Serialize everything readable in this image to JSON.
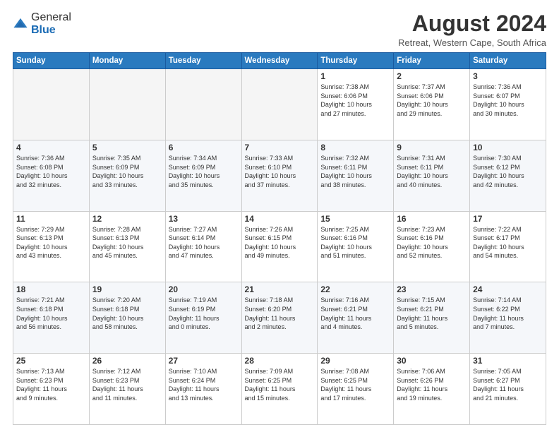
{
  "logo": {
    "general": "General",
    "blue": "Blue"
  },
  "title": "August 2024",
  "location": "Retreat, Western Cape, South Africa",
  "days_of_week": [
    "Sunday",
    "Monday",
    "Tuesday",
    "Wednesday",
    "Thursday",
    "Friday",
    "Saturday"
  ],
  "weeks": [
    [
      {
        "day": "",
        "info": "",
        "empty": true
      },
      {
        "day": "",
        "info": "",
        "empty": true
      },
      {
        "day": "",
        "info": "",
        "empty": true
      },
      {
        "day": "",
        "info": "",
        "empty": true
      },
      {
        "day": "1",
        "info": "Sunrise: 7:38 AM\nSunset: 6:06 PM\nDaylight: 10 hours\nand 27 minutes."
      },
      {
        "day": "2",
        "info": "Sunrise: 7:37 AM\nSunset: 6:06 PM\nDaylight: 10 hours\nand 29 minutes."
      },
      {
        "day": "3",
        "info": "Sunrise: 7:36 AM\nSunset: 6:07 PM\nDaylight: 10 hours\nand 30 minutes."
      }
    ],
    [
      {
        "day": "4",
        "info": "Sunrise: 7:36 AM\nSunset: 6:08 PM\nDaylight: 10 hours\nand 32 minutes."
      },
      {
        "day": "5",
        "info": "Sunrise: 7:35 AM\nSunset: 6:09 PM\nDaylight: 10 hours\nand 33 minutes."
      },
      {
        "day": "6",
        "info": "Sunrise: 7:34 AM\nSunset: 6:09 PM\nDaylight: 10 hours\nand 35 minutes."
      },
      {
        "day": "7",
        "info": "Sunrise: 7:33 AM\nSunset: 6:10 PM\nDaylight: 10 hours\nand 37 minutes."
      },
      {
        "day": "8",
        "info": "Sunrise: 7:32 AM\nSunset: 6:11 PM\nDaylight: 10 hours\nand 38 minutes."
      },
      {
        "day": "9",
        "info": "Sunrise: 7:31 AM\nSunset: 6:11 PM\nDaylight: 10 hours\nand 40 minutes."
      },
      {
        "day": "10",
        "info": "Sunrise: 7:30 AM\nSunset: 6:12 PM\nDaylight: 10 hours\nand 42 minutes."
      }
    ],
    [
      {
        "day": "11",
        "info": "Sunrise: 7:29 AM\nSunset: 6:13 PM\nDaylight: 10 hours\nand 43 minutes."
      },
      {
        "day": "12",
        "info": "Sunrise: 7:28 AM\nSunset: 6:13 PM\nDaylight: 10 hours\nand 45 minutes."
      },
      {
        "day": "13",
        "info": "Sunrise: 7:27 AM\nSunset: 6:14 PM\nDaylight: 10 hours\nand 47 minutes."
      },
      {
        "day": "14",
        "info": "Sunrise: 7:26 AM\nSunset: 6:15 PM\nDaylight: 10 hours\nand 49 minutes."
      },
      {
        "day": "15",
        "info": "Sunrise: 7:25 AM\nSunset: 6:16 PM\nDaylight: 10 hours\nand 51 minutes."
      },
      {
        "day": "16",
        "info": "Sunrise: 7:23 AM\nSunset: 6:16 PM\nDaylight: 10 hours\nand 52 minutes."
      },
      {
        "day": "17",
        "info": "Sunrise: 7:22 AM\nSunset: 6:17 PM\nDaylight: 10 hours\nand 54 minutes."
      }
    ],
    [
      {
        "day": "18",
        "info": "Sunrise: 7:21 AM\nSunset: 6:18 PM\nDaylight: 10 hours\nand 56 minutes."
      },
      {
        "day": "19",
        "info": "Sunrise: 7:20 AM\nSunset: 6:18 PM\nDaylight: 10 hours\nand 58 minutes."
      },
      {
        "day": "20",
        "info": "Sunrise: 7:19 AM\nSunset: 6:19 PM\nDaylight: 11 hours\nand 0 minutes."
      },
      {
        "day": "21",
        "info": "Sunrise: 7:18 AM\nSunset: 6:20 PM\nDaylight: 11 hours\nand 2 minutes."
      },
      {
        "day": "22",
        "info": "Sunrise: 7:16 AM\nSunset: 6:21 PM\nDaylight: 11 hours\nand 4 minutes."
      },
      {
        "day": "23",
        "info": "Sunrise: 7:15 AM\nSunset: 6:21 PM\nDaylight: 11 hours\nand 5 minutes."
      },
      {
        "day": "24",
        "info": "Sunrise: 7:14 AM\nSunset: 6:22 PM\nDaylight: 11 hours\nand 7 minutes."
      }
    ],
    [
      {
        "day": "25",
        "info": "Sunrise: 7:13 AM\nSunset: 6:23 PM\nDaylight: 11 hours\nand 9 minutes."
      },
      {
        "day": "26",
        "info": "Sunrise: 7:12 AM\nSunset: 6:23 PM\nDaylight: 11 hours\nand 11 minutes."
      },
      {
        "day": "27",
        "info": "Sunrise: 7:10 AM\nSunset: 6:24 PM\nDaylight: 11 hours\nand 13 minutes."
      },
      {
        "day": "28",
        "info": "Sunrise: 7:09 AM\nSunset: 6:25 PM\nDaylight: 11 hours\nand 15 minutes."
      },
      {
        "day": "29",
        "info": "Sunrise: 7:08 AM\nSunset: 6:25 PM\nDaylight: 11 hours\nand 17 minutes."
      },
      {
        "day": "30",
        "info": "Sunrise: 7:06 AM\nSunset: 6:26 PM\nDaylight: 11 hours\nand 19 minutes."
      },
      {
        "day": "31",
        "info": "Sunrise: 7:05 AM\nSunset: 6:27 PM\nDaylight: 11 hours\nand 21 minutes."
      }
    ]
  ]
}
